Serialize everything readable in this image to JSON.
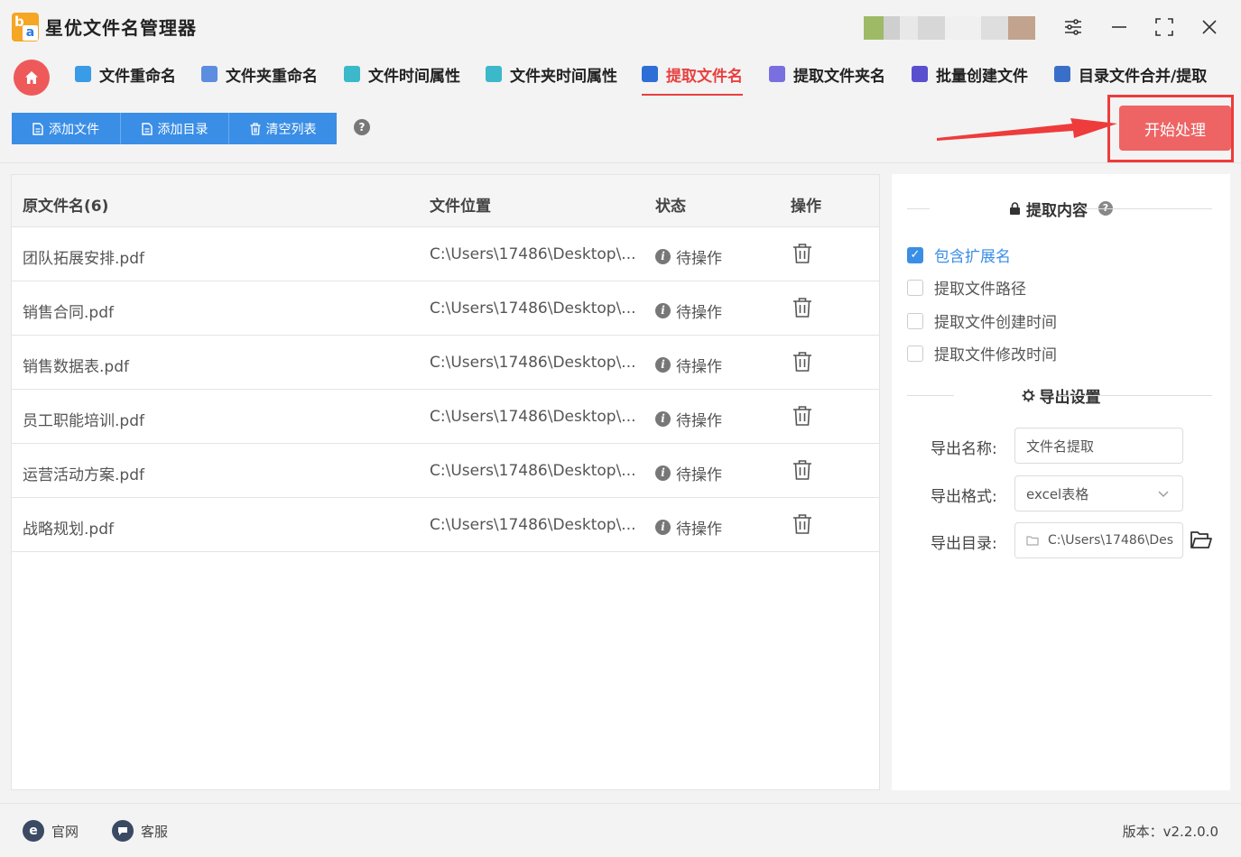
{
  "app": {
    "title": "星优文件名管理器",
    "logo_letter_b": "b",
    "logo_letter_a": "a"
  },
  "window_controls": [
    "settings-icon",
    "minimize-icon",
    "maximize-icon",
    "close-icon"
  ],
  "tabs": [
    {
      "label": "文件重命名",
      "icon": "rename-icon",
      "color": "#3a9be6"
    },
    {
      "label": "文件夹重命名",
      "icon": "folder-rename-icon",
      "color": "#5b8de0"
    },
    {
      "label": "文件时间属性",
      "icon": "file-time-icon",
      "color": "#3bb8c9"
    },
    {
      "label": "文件夹时间属性",
      "icon": "folder-time-icon",
      "color": "#3bb8c9"
    },
    {
      "label": "提取文件名",
      "icon": "extract-filename-icon",
      "color": "#2d6fd6",
      "active": true
    },
    {
      "label": "提取文件夹名",
      "icon": "extract-folder-icon",
      "color": "#7a6fe0"
    },
    {
      "label": "批量创建文件",
      "icon": "batch-create-icon",
      "color": "#5a4fcf"
    },
    {
      "label": "目录文件合并/提取",
      "icon": "merge-icon",
      "color": "#3a6fc9"
    }
  ],
  "toolbar": {
    "add_file": "添加文件",
    "add_dir": "添加目录",
    "clear_list": "清空列表",
    "start": "开始处理"
  },
  "table": {
    "headers": {
      "name": "原文件名(6)",
      "location": "文件位置",
      "status": "状态",
      "action": "操作"
    },
    "rows": [
      {
        "name": "团队拓展安排.pdf",
        "location": "C:\\Users\\17486\\Desktop\\...",
        "status": "待操作"
      },
      {
        "name": "销售合同.pdf",
        "location": "C:\\Users\\17486\\Desktop\\...",
        "status": "待操作"
      },
      {
        "name": "销售数据表.pdf",
        "location": "C:\\Users\\17486\\Desktop\\...",
        "status": "待操作"
      },
      {
        "name": "员工职能培训.pdf",
        "location": "C:\\Users\\17486\\Desktop\\...",
        "status": "待操作"
      },
      {
        "name": "运营活动方案.pdf",
        "location": "C:\\Users\\17486\\Desktop\\...",
        "status": "待操作"
      },
      {
        "name": "战略规划.pdf",
        "location": "C:\\Users\\17486\\Desktop\\...",
        "status": "待操作"
      }
    ]
  },
  "side": {
    "extract_title": "提取内容",
    "options": [
      {
        "label": "包含扩展名",
        "checked": true
      },
      {
        "label": "提取文件路径",
        "checked": false
      },
      {
        "label": "提取文件创建时间",
        "checked": false
      },
      {
        "label": "提取文件修改时间",
        "checked": false
      }
    ],
    "export_title": "导出设置",
    "export_name_label": "导出名称:",
    "export_name_value": "文件名提取",
    "export_format_label": "导出格式:",
    "export_format_value": "excel表格",
    "export_dir_label": "导出目录:",
    "export_dir_value": "C:\\Users\\17486\\Des"
  },
  "footer": {
    "website": "官网",
    "support": "客服",
    "version": "版本：v2.2.0.0"
  },
  "colors": {
    "accent": "#3a8ee6",
    "active_tab": "#e8403f",
    "start": "#ee6464",
    "highlight": "#ee3b3b"
  }
}
